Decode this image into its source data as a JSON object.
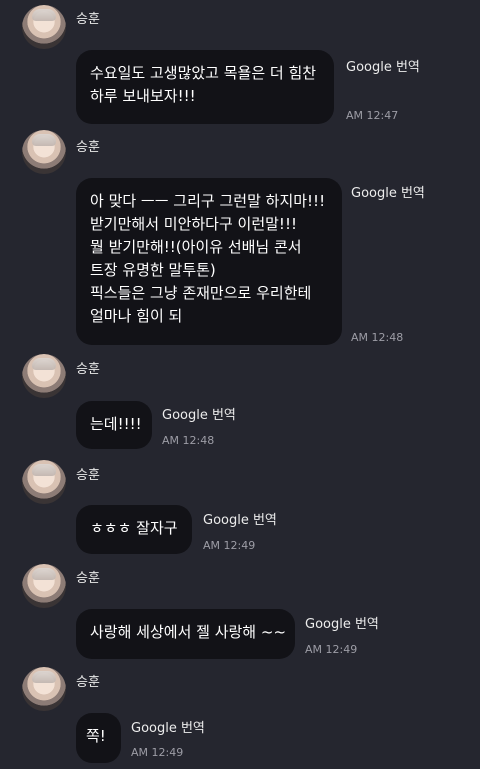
{
  "messages": [
    {
      "sender": "승훈",
      "lines": [
        "수요일도 고생많았고 목욜은 더 힘찬",
        "하루 보내보자!!!"
      ],
      "translate_label": "Google 번역",
      "time": "AM 12:47"
    },
    {
      "sender": "승훈",
      "lines": [
        "아 맞다 ㅡㅡ 그리구 그런말 하지마!!!",
        "받기만해서 미안하다구 이런말!!!",
        "뭘 받기만해!!(아이유 선배님 콘서",
        "트장 유명한 말투톤)",
        "픽스들은 그냥 존재만으로 우리한테",
        " 얼마나 힘이 되"
      ],
      "translate_label": "Google 번역",
      "time": "AM 12:48"
    },
    {
      "sender": "승훈",
      "lines": [
        "는데!!!!"
      ],
      "translate_label": "Google 번역",
      "time": "AM 12:48"
    },
    {
      "sender": "승훈",
      "lines": [
        "ㅎㅎㅎ 잘자구"
      ],
      "translate_label": "Google 번역",
      "time": "AM 12:49"
    },
    {
      "sender": "승훈",
      "lines": [
        "사랑해 세상에서 젤 사랑해 ~~"
      ],
      "translate_label": "Google 번역",
      "time": "AM 12:49"
    },
    {
      "sender": "승훈",
      "lines": [
        "쪽!"
      ],
      "translate_label": "Google 번역",
      "time": "AM 12:49"
    }
  ]
}
